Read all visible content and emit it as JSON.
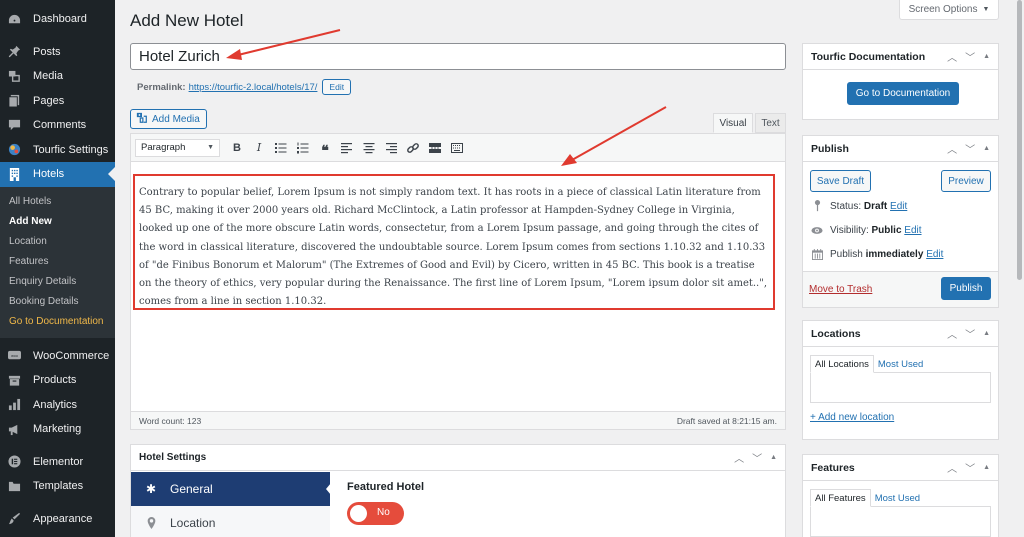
{
  "sidebar": {
    "items": [
      {
        "label": "Dashboard",
        "icon": "dashboard-icon"
      },
      {
        "label": "Posts",
        "icon": "pin-icon"
      },
      {
        "label": "Media",
        "icon": "media-icon"
      },
      {
        "label": "Pages",
        "icon": "pages-icon"
      },
      {
        "label": "Comments",
        "icon": "comment-icon"
      },
      {
        "label": "Tourfic Settings",
        "icon": "tourfic-logo-icon"
      },
      {
        "label": "Hotels",
        "icon": "building-icon",
        "active": true
      },
      {
        "label": "WooCommerce",
        "icon": "woocommerce-icon"
      },
      {
        "label": "Products",
        "icon": "archive-box-icon"
      },
      {
        "label": "Analytics",
        "icon": "bar-chart-icon"
      },
      {
        "label": "Marketing",
        "icon": "megaphone-icon"
      },
      {
        "label": "Elementor",
        "icon": "elementor-icon"
      },
      {
        "label": "Templates",
        "icon": "folder-icon"
      },
      {
        "label": "Appearance",
        "icon": "paintbrush-icon"
      }
    ],
    "hotels_submenu": [
      {
        "label": "All Hotels"
      },
      {
        "label": "Add New",
        "current": true
      },
      {
        "label": "Location"
      },
      {
        "label": "Features"
      },
      {
        "label": "Enquiry Details"
      },
      {
        "label": "Booking Details"
      },
      {
        "label": "Go to Documentation",
        "highlight": true
      }
    ]
  },
  "header": {
    "title": "Add New Hotel",
    "screen_options": "Screen Options"
  },
  "post": {
    "title_value": "Hotel Zurich",
    "permalink_label": "Permalink:",
    "permalink_url": "https://tourfic-2.local/hotels/17/",
    "permalink_edit": "Edit"
  },
  "editor": {
    "add_media": "Add Media",
    "tabs": {
      "visual": "Visual",
      "text": "Text"
    },
    "format_select": "Paragraph",
    "toolbar_buttons": [
      "bold",
      "italic",
      "bulleted-list",
      "numbered-list",
      "blockquote",
      "align-left",
      "align-center",
      "align-right",
      "insert-link",
      "read-more",
      "toolbar-toggle"
    ],
    "content": "Contrary to popular belief, Lorem Ipsum is not simply random text. It has roots in a piece of classical Latin literature from 45 BC, making it over 2000 years old. Richard McClintock, a Latin professor at Hampden-Sydney College in Virginia, looked up one of the more obscure Latin words, consectetur, from a Lorem Ipsum passage, and going through the cites of the word in classical literature, discovered the undoubtable source. Lorem Ipsum comes from sections 1.10.32 and 1.10.33 of \"de Finibus Bonorum et Malorum\" (The Extremes of Good and Evil) by Cicero, written in 45 BC. This book is a treatise on the theory of ethics, very popular during the Renaissance. The first line of Lorem Ipsum, \"Lorem ipsum dolor sit amet..\", comes from a line in section 1.10.32.",
    "word_count": "Word count: 123",
    "draft_saved": "Draft saved at 8:21:15 am."
  },
  "hotel_settings": {
    "title": "Hotel Settings",
    "tabs": [
      {
        "label": "General",
        "icon": "gear-icon",
        "active": true
      },
      {
        "label": "Location",
        "icon": "map-pin-icon"
      }
    ],
    "featured_label": "Featured Hotel",
    "featured_toggle": "No",
    "featured_on": false
  },
  "doc_box": {
    "title": "Tourfic Documentation",
    "button": "Go to Documentation"
  },
  "publish_box": {
    "title": "Publish",
    "save_draft": "Save Draft",
    "preview": "Preview",
    "status_label": "Status:",
    "status_value": "Draft",
    "visibility_label": "Visibility:",
    "visibility_value": "Public",
    "publish_label": "Publish",
    "publish_value": "immediately",
    "edit": "Edit",
    "trash": "Move to Trash",
    "publish_button": "Publish"
  },
  "locations_box": {
    "title": "Locations",
    "tab_all": "All Locations",
    "tab_most_used": "Most Used",
    "add_new": "+ Add new location"
  },
  "features_box": {
    "title": "Features",
    "tab_all": "All Features",
    "tab_most_used": "Most Used"
  },
  "colors": {
    "admin_accent": "#2271b1",
    "sidebar_bg": "#1d2327",
    "annotation_red": "#e03a2f",
    "settings_nav_active": "#1e3d73",
    "toggle_off": "#e54c3c",
    "submenu_highlight": "#f0b849"
  }
}
